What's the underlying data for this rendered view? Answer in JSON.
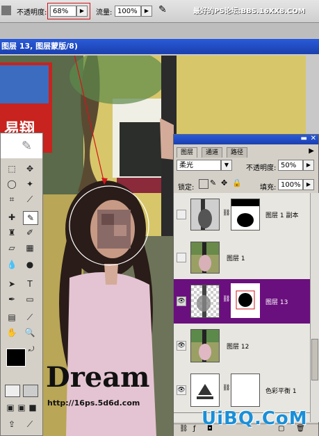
{
  "options_bar": {
    "opacity_label": "不透明度:",
    "opacity_value": "68%",
    "flow_label": "流量:",
    "flow_value": "100%",
    "watermark_text": "最好的PS论坛:BBS.16XX8.COM"
  },
  "document": {
    "title": "图层 13, 图层蒙版/8)",
    "photo_text_dream": "Dream",
    "photo_text_url": "http://16ps.5d6d.com",
    "photo_sign_text": "易翔"
  },
  "layers_panel": {
    "tabs": [
      "图层",
      "通道",
      "路径"
    ],
    "blend_mode": "柔光",
    "opacity_label": "不透明度:",
    "opacity_value": "50%",
    "lock_label": "锁定:",
    "fill_label": "填充:",
    "fill_value": "100%",
    "layers": [
      {
        "name": "图层 1 副本",
        "visible": false,
        "selected": false
      },
      {
        "name": "图层 1",
        "visible": false,
        "selected": false
      },
      {
        "name": "图层 13",
        "visible": true,
        "selected": true
      },
      {
        "name": "图层 12",
        "visible": true,
        "selected": false
      },
      {
        "name": "色彩平衡 1",
        "visible": true,
        "selected": false
      }
    ]
  },
  "site_watermark": "UiBQ.CoM",
  "colors": {
    "selected_layer": "#6a0f7e",
    "title_bar": "#1a3fae",
    "annotation_red": "#d4141a"
  }
}
